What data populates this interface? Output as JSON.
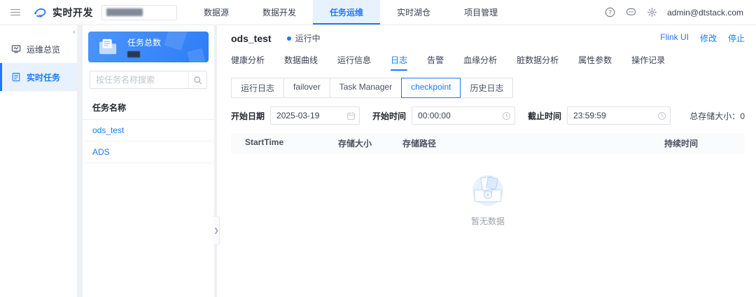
{
  "topbar": {
    "brand": "实时开发",
    "nav": [
      "数据源",
      "数据开发",
      "任务运维",
      "实时湖仓",
      "项目管理"
    ],
    "user_email": "admin@dtstack.com"
  },
  "sidebar": {
    "items": [
      {
        "label": "运维总览"
      },
      {
        "label": "实时任务"
      }
    ]
  },
  "task_panel": {
    "card_title": "任务总数",
    "search_placeholder": "按任务名称搜索",
    "list_header": "任务名称",
    "tasks": [
      "ods_test",
      "ADS"
    ]
  },
  "main": {
    "title": "ods_test",
    "status": "运行中",
    "actions": [
      "Flink UI",
      "修改",
      "停止"
    ],
    "tabs": [
      "健康分析",
      "数据曲线",
      "运行信息",
      "日志",
      "告警",
      "血缘分析",
      "脏数据分析",
      "属性参数",
      "操作记录"
    ],
    "subtabs": [
      "运行日志",
      "failover",
      "Task Manager",
      "checkpoint",
      "历史日志"
    ],
    "filters": {
      "start_date_label": "开始日期",
      "start_date_value": "2025-03-19",
      "start_time_label": "开始时间",
      "start_time_value": "00:00:00",
      "end_time_label": "截止时间",
      "end_time_value": "23:59:59",
      "total_storage_label": "总存储大小：",
      "total_storage_value": "0"
    },
    "table": {
      "columns": [
        "StartTime",
        "存储大小",
        "存储路径",
        "持续时间"
      ]
    },
    "empty_text": "暂无数据"
  },
  "colors": {
    "accent": "#1d78ff",
    "accent_bg": "#e8f2ff",
    "card_blue": "#3280f7"
  }
}
